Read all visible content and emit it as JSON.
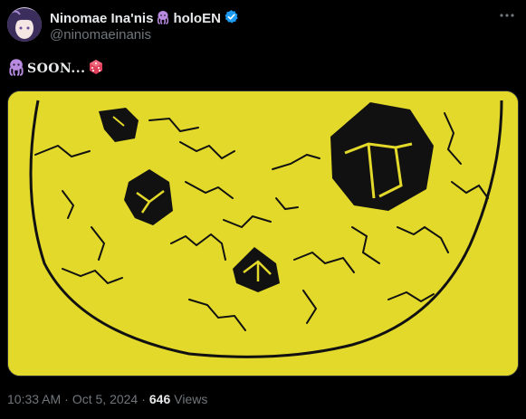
{
  "author": {
    "display_name": "Ninomae Ina'nis",
    "org_label": "holoEN",
    "handle": "@ninomaeinanis",
    "octopus_icon": "octopus-emoji",
    "verified_icon": "verified-badge-icon",
    "avatar_icon": "profile-avatar"
  },
  "tweet": {
    "text_prefix_icon": "octopus-emoji",
    "text": "SOON...",
    "text_suffix_icon": "die-emoji",
    "media_icon": "cookie-artwork"
  },
  "meta": {
    "time": "10:33 AM",
    "date": "Oct 5, 2024",
    "separator1": "·",
    "separator2": "·",
    "views_count": "646",
    "views_label": "Views"
  },
  "colors": {
    "background": "#000000",
    "text_primary": "#e7e9ea",
    "text_secondary": "#71767b",
    "verified_blue": "#1d9bf0",
    "octopus_purple": "#b88be0",
    "cookie_yellow": "#e3d92b",
    "die_red": "#e0405a"
  }
}
